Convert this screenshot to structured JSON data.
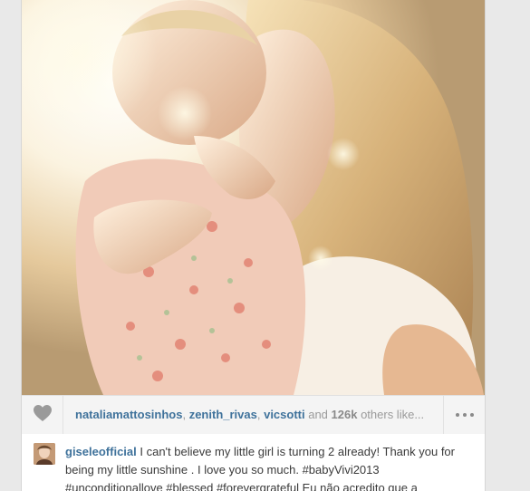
{
  "post": {
    "likes": {
      "users": [
        "nataliamattosinhos",
        "zenith_rivas",
        "vicsotti"
      ],
      "separator": ", ",
      "and_text": " and ",
      "count": "126k",
      "suffix": " others like..."
    },
    "caption": {
      "username": "giseleofficial",
      "text": " I can't believe my little girl is turning 2 already! Thank you for being my little sunshine . I love you so much. #babyVivi2013 #unconditionallove #blessed #forevergrateful Eu não acredito que a"
    }
  },
  "icons": {
    "like": "heart-icon",
    "more": "more-dots-icon"
  },
  "colors": {
    "link": "#3f729b",
    "muted": "#9a9a9a",
    "background": "#e9e9e9"
  }
}
